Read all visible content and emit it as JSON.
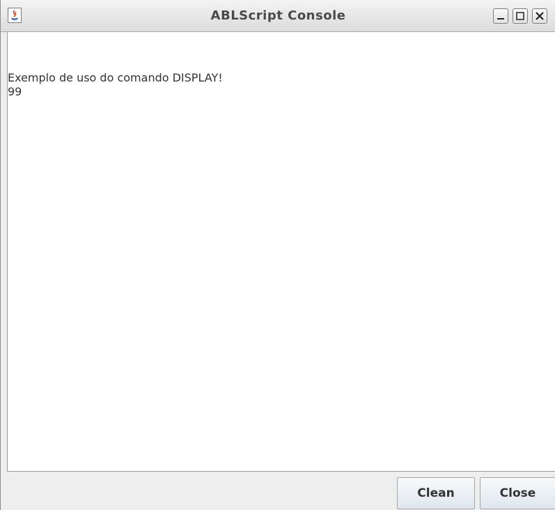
{
  "window": {
    "title": "ABLScript Console",
    "icon": "java-cup-icon",
    "controls": [
      "minimize-icon",
      "maximize-icon",
      "close-icon"
    ]
  },
  "console": {
    "lines": [
      "Exemplo de uso do comando DISPLAY!",
      "99"
    ]
  },
  "buttons": {
    "clean_label": "Clean",
    "close_label": "Close"
  }
}
